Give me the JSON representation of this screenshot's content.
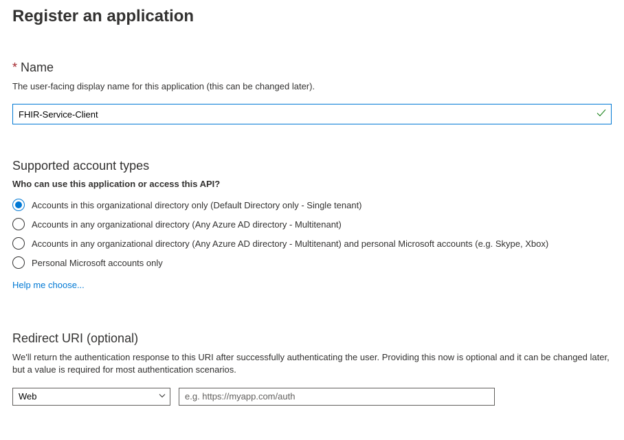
{
  "page": {
    "title": "Register an application"
  },
  "name_section": {
    "label": "Name",
    "description": "The user-facing display name for this application (this can be changed later).",
    "value": "FHIR-Service-Client"
  },
  "account_types": {
    "heading": "Supported account types",
    "question": "Who can use this application or access this API?",
    "options": [
      {
        "label": "Accounts in this organizational directory only (Default Directory only - Single tenant)",
        "selected": true
      },
      {
        "label": "Accounts in any organizational directory (Any Azure AD directory - Multitenant)",
        "selected": false
      },
      {
        "label": "Accounts in any organizational directory (Any Azure AD directory - Multitenant) and personal Microsoft accounts (e.g. Skype, Xbox)",
        "selected": false
      },
      {
        "label": "Personal Microsoft accounts only",
        "selected": false
      }
    ],
    "help_link": "Help me choose..."
  },
  "redirect": {
    "heading": "Redirect URI (optional)",
    "description": "We'll return the authentication response to this URI after successfully authenticating the user. Providing this now is optional and it can be changed later, but a value is required for most authentication scenarios.",
    "platform_selected": "Web",
    "uri_placeholder": "e.g. https://myapp.com/auth",
    "uri_value": ""
  }
}
